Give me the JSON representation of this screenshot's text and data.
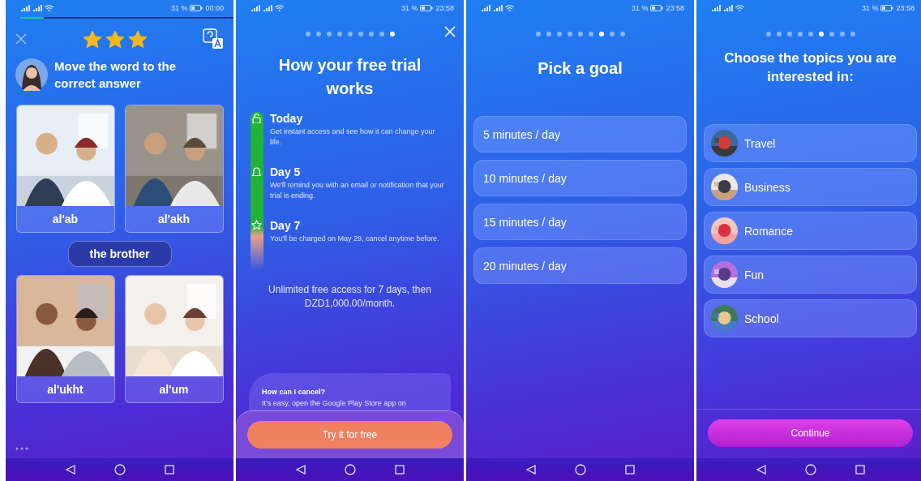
{
  "screens": [
    {
      "kind": "quiz",
      "status_bar": {
        "battery": "31 %",
        "time": "00:00"
      },
      "progress": {
        "level": 0.11
      },
      "rating": {
        "stars": 3
      },
      "prompt": "Move the word to the correct answer",
      "cards": [
        {
          "label": "al'ab"
        },
        {
          "label": "al'akh"
        },
        {
          "label": "al'ukht"
        },
        {
          "label": "al'um"
        }
      ],
      "drag_word": "the brother"
    },
    {
      "kind": "trial",
      "status_bar": {
        "battery": "31 %",
        "time": "23:58"
      },
      "pager": [
        {
          "selected": false
        },
        {
          "selected": false
        },
        {
          "selected": false
        },
        {
          "selected": false
        },
        {
          "selected": false
        },
        {
          "selected": false
        },
        {
          "selected": false
        },
        {
          "selected": false
        },
        {
          "selected": true
        }
      ],
      "title": "How your free trial works",
      "steps": [
        {
          "kind": "unlock",
          "title": "Today",
          "text": "Get instant access and see how it can change your life."
        },
        {
          "kind": "bell",
          "title": "Day 5",
          "text": "We'll remind you with an email or notification that your trial is ending."
        },
        {
          "kind": "star",
          "title": "Day 7",
          "text": "You'll be charged on May 29, cancel anytime before."
        }
      ],
      "offer": "Unlimited free access for 7 days, then DZD1,000.00/month.",
      "faq": {
        "question": "How can I cancel?",
        "answer": "It's easy, open the Google Play Store app on"
      },
      "button": "Try it for free"
    },
    {
      "kind": "goal",
      "status_bar": {
        "battery": "31 %",
        "time": "23:58"
      },
      "pager": [
        {
          "selected": false
        },
        {
          "selected": false
        },
        {
          "selected": false
        },
        {
          "selected": false
        },
        {
          "selected": false
        },
        {
          "selected": false
        },
        {
          "selected": true
        },
        {
          "selected": false
        },
        {
          "selected": false
        }
      ],
      "title": "Pick a goal",
      "options": [
        {
          "label": "5 minutes / day"
        },
        {
          "label": "10 minutes / day"
        },
        {
          "label": "15 minutes / day"
        },
        {
          "label": "20 minutes / day"
        }
      ]
    },
    {
      "kind": "topics",
      "status_bar": {
        "battery": "31 %",
        "time": "23:58"
      },
      "pager": [
        {
          "selected": false
        },
        {
          "selected": false
        },
        {
          "selected": false
        },
        {
          "selected": false
        },
        {
          "selected": false
        },
        {
          "selected": true
        },
        {
          "selected": false
        },
        {
          "selected": false
        },
        {
          "selected": false
        }
      ],
      "title": "Choose the topics you are interested in:",
      "topics": [
        {
          "label": "Travel"
        },
        {
          "label": "Business"
        },
        {
          "label": "Romance"
        },
        {
          "label": "Fun"
        },
        {
          "label": "School"
        }
      ],
      "button": "Continue"
    }
  ]
}
